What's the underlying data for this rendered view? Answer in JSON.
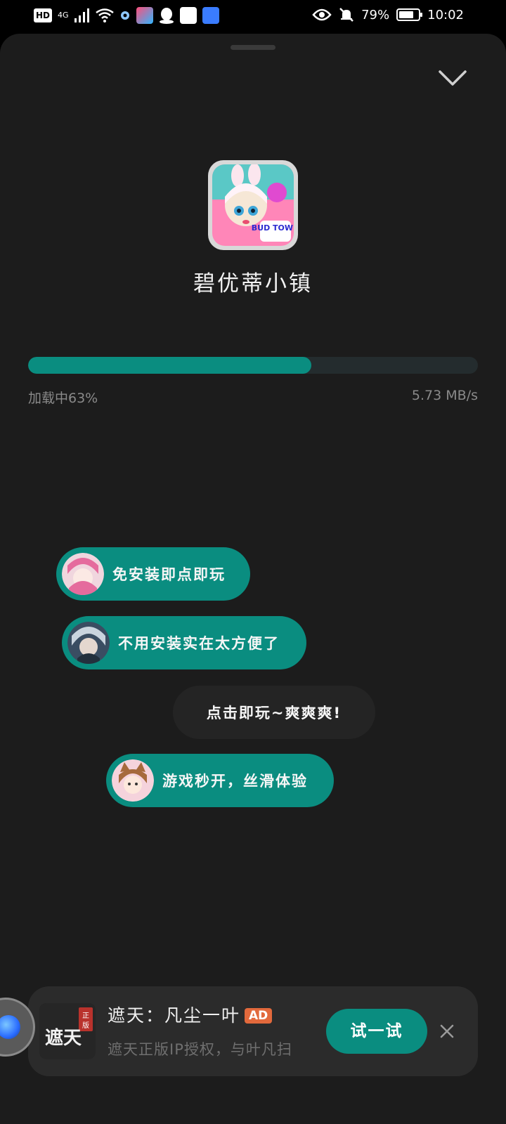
{
  "status_bar": {
    "hd_badge": "HD",
    "network": "4G",
    "battery_percent": "79%",
    "battery_level": 0.79,
    "time": "10:02"
  },
  "app": {
    "name": "碧优蒂小镇",
    "icon_text": "BUD TOWN"
  },
  "download": {
    "status_text": "加载中63%",
    "progress": 0.63,
    "speed": "5.73 MB/s"
  },
  "bubbles": [
    {
      "text": "免安装即点即玩",
      "style": "teal",
      "avatar": "avatar-pink-hair"
    },
    {
      "text": "不用安装实在太方便了",
      "style": "teal",
      "avatar": "avatar-silver-hair"
    },
    {
      "text": "点击即玩~爽爽爽!",
      "style": "dark",
      "avatar": ""
    },
    {
      "text": "游戏秒开，丝滑体验",
      "style": "teal",
      "avatar": "avatar-cat-ears"
    }
  ],
  "ad": {
    "icon_text": "遮天",
    "icon_badge": "正版",
    "title": "遮天：凡尘一叶",
    "badge": "AD",
    "description": "遮天正版IP授权，与叶凡扫",
    "cta": "试一试"
  },
  "colors": {
    "accent": "#0a8d80",
    "sheet_bg": "#1c1c1c",
    "track": "#242c2e",
    "ad_badge": "#e2693c"
  }
}
